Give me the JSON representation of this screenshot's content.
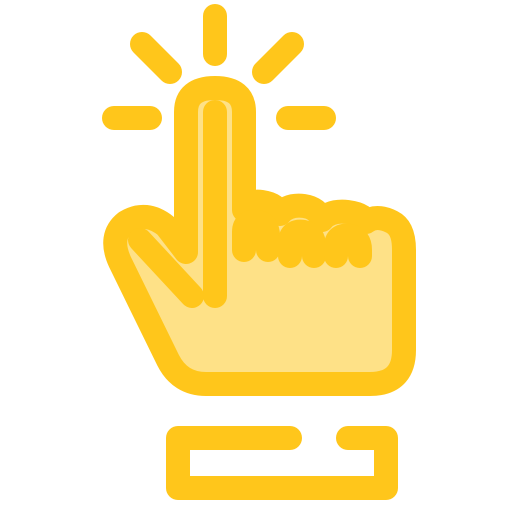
{
  "icon": {
    "name": "tap-gesture-icon",
    "stroke_color": "#FFC61B",
    "fill_color": "#FEE187",
    "background": "#FFFFFF"
  }
}
